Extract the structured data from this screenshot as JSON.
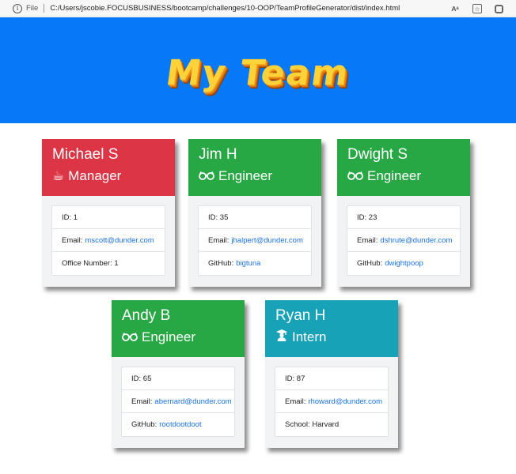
{
  "browser": {
    "info_icon": "i",
    "file_label": "File",
    "url": "C:/Users/jscobie.FOCUSBUSINESS/bootcamp/challenges/10-OOP/TeamProfileGenerator/dist/index.html",
    "read_aloud_label": "Aᵃ"
  },
  "header": {
    "title": "My Team",
    "bg_color": "#0679f9",
    "title_color": "#ffd23a"
  },
  "cards": [
    {
      "name": "Michael S",
      "role": "Manager",
      "icon": "coffee-icon",
      "glyph": "☕",
      "color": "#dc3545",
      "id_label": "ID:",
      "id": "1",
      "email_label": "Email:",
      "email": "mscott@dunder.com",
      "extra_label": "Office Number:",
      "extra": "1"
    },
    {
      "name": "Jim H",
      "role": "Engineer",
      "icon": "glasses-icon",
      "glyph": "🕶",
      "color": "#28a745",
      "id_label": "ID:",
      "id": "35",
      "email_label": "Email:",
      "email": "jhalpert@dunder.com",
      "extra_label": "GitHub:",
      "extra": "bigtuna"
    },
    {
      "name": "Dwight S",
      "role": "Engineer",
      "icon": "glasses-icon",
      "glyph": "🕶",
      "color": "#28a745",
      "id_label": "ID:",
      "id": "23",
      "email_label": "Email:",
      "email": "dshrute@dunder.com",
      "extra_label": "GitHub:",
      "extra": "dwightpoop"
    },
    {
      "name": "Andy B",
      "role": "Engineer",
      "icon": "glasses-icon",
      "glyph": "🕶",
      "color": "#28a745",
      "id_label": "ID:",
      "id": "65",
      "email_label": "Email:",
      "email": "abernard@dunder.com",
      "extra_label": "GitHub:",
      "extra": "rootdootdoot"
    },
    {
      "name": "Ryan H",
      "role": "Intern",
      "icon": "graduate-icon",
      "glyph": "🎓",
      "color": "#17a2b8",
      "id_label": "ID:",
      "id": "87",
      "email_label": "Email:",
      "email": "rhoward@dunder.com",
      "extra_label": "School:",
      "extra": "Harvard"
    }
  ]
}
